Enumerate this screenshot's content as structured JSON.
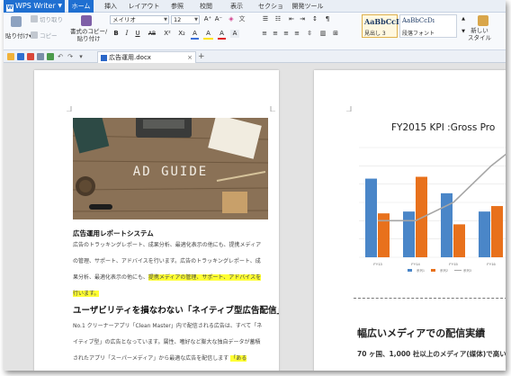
{
  "app": {
    "name": "WPS Writer",
    "tabs": [
      "ホーム",
      "挿入",
      "レイアウト",
      "参照",
      "校閲",
      "表示",
      "セクション",
      "開発ツール"
    ],
    "active_tab": "ホーム"
  },
  "ribbon": {
    "paste": "貼り付け",
    "cut": "切り取り",
    "copy": "コピー",
    "format_painter": "書式のコピー/\n貼り付け",
    "font_name": "メイリオ",
    "font_size": "12",
    "style_1_sample": "AaBbCcI",
    "style_1_name": "見出し 3",
    "style_2_sample": "AaBbCcDı",
    "style_2_name": "段落フォント",
    "new_style": "新しい\nスタイル",
    "format_buttons": [
      "B",
      "I",
      "U",
      "AB",
      "X²",
      "X₂",
      "A",
      "A",
      "A"
    ],
    "grow_font": "A⁺",
    "shrink_font": "A⁻"
  },
  "document_tab": {
    "name": "広告運用.docx",
    "new_tab": "+"
  },
  "page1": {
    "hero_title": "AD GUIDE",
    "heading1": "広告運用レポートシステム",
    "para1": [
      "広告のトラッキングレポート、成果分析、最適化表示の他にも、提携メディア",
      "の管理、サポート、アドバイスを行います。広告のトラッキングレポート、成",
      "果分析、最適化表示の他にも、",
      "提携メディアの管理、サポート、アドバイスを",
      "行います。"
    ],
    "heading2": "ユーザビリティを損なわない「ネイティブ型広告配信」",
    "para2": [
      "No.1 クリーナーアプリ「Clean Master」内で配信される広告は、すべて「ネ",
      "イティブ型」の広告となっています。属性、嗜好など膨大な独自データが蓄積",
      "されたアプリ「スーパーメディア」から最適な広告を配信します"
    ],
    "para2_tail": "「ある"
  },
  "page2": {
    "heading": "幅広いメディアでの配信実績",
    "sub": "70 ヶ国、1,000 社以上のメディア(媒体)で高い"
  },
  "chart_data": {
    "type": "bar",
    "title": "FY2015 KPI :Gross Pro",
    "categories": [
      "FY13",
      "FY14",
      "FY15",
      "FY16"
    ],
    "series": [
      {
        "name": "系列1",
        "color": "#4a86c8",
        "values": [
          4.3,
          2.5,
          3.5,
          2.5
        ]
      },
      {
        "name": "系列2",
        "color": "#e8711c",
        "values": [
          2.4,
          4.4,
          1.8,
          2.8
        ]
      },
      {
        "name": "系列3",
        "color": "#a6a6a6",
        "values": [
          2.0,
          2.0,
          3.0,
          5.0
        ],
        "kind": "line"
      }
    ],
    "ylim": [
      0,
      6
    ],
    "grid": true,
    "legend": "bottom"
  }
}
